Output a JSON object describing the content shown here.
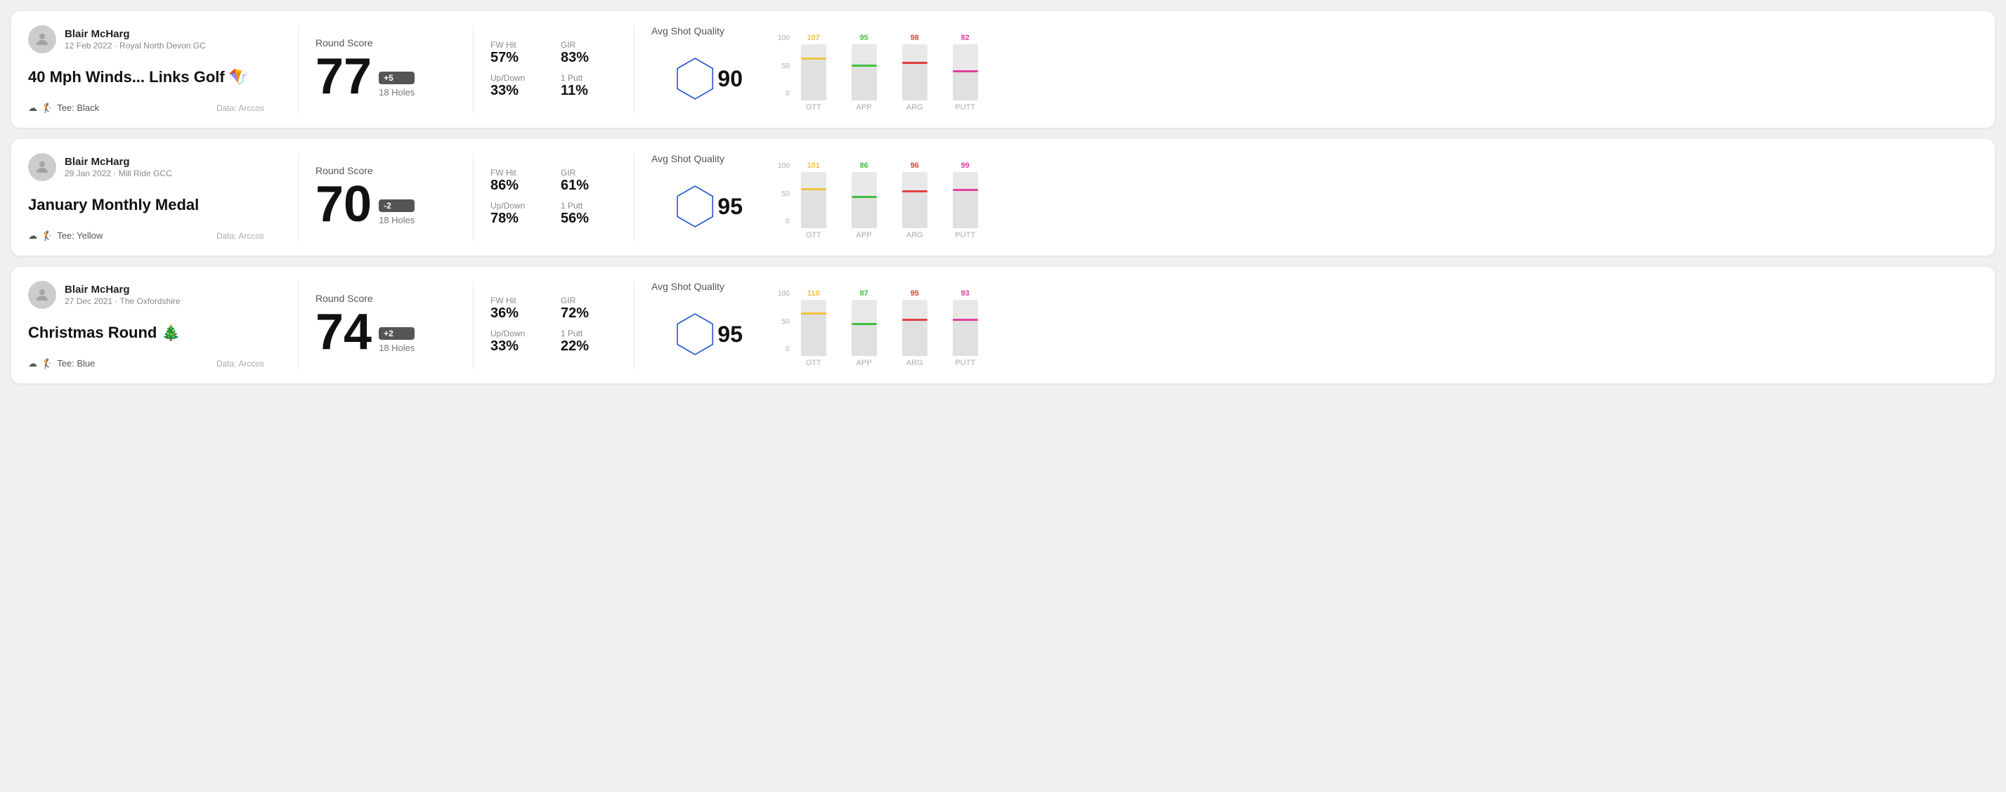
{
  "rounds": [
    {
      "id": "round-1",
      "user": "Blair McHarg",
      "date": "12 Feb 2022 · Royal North Devon GC",
      "title": "40 Mph Winds... Links Golf 🪁",
      "tee": "Black",
      "data_source": "Data: Arccos",
      "round_score_label": "Round Score",
      "score": "77",
      "score_diff": "+5",
      "score_diff_type": "positive",
      "holes": "18 Holes",
      "fw_hit_label": "FW Hit",
      "fw_hit": "57%",
      "gir_label": "GIR",
      "gir": "83%",
      "updown_label": "Up/Down",
      "updown": "33%",
      "putt1_label": "1 Putt",
      "putt1": "11%",
      "quality_label": "Avg Shot Quality",
      "quality_score": "90",
      "chart": {
        "columns": [
          {
            "label": "OTT",
            "value": 107,
            "color": "#f0c040",
            "bar_pct": 72
          },
          {
            "label": "APP",
            "value": 95,
            "color": "#40c040",
            "bar_pct": 60
          },
          {
            "label": "ARG",
            "value": 98,
            "color": "#e04040",
            "bar_pct": 65
          },
          {
            "label": "PUTT",
            "value": 82,
            "color": "#e040a0",
            "bar_pct": 50
          }
        ]
      }
    },
    {
      "id": "round-2",
      "user": "Blair McHarg",
      "date": "29 Jan 2022 · Mill Ride GCC",
      "title": "January Monthly Medal",
      "tee": "Yellow",
      "data_source": "Data: Arccos",
      "round_score_label": "Round Score",
      "score": "70",
      "score_diff": "-2",
      "score_diff_type": "negative",
      "holes": "18 Holes",
      "fw_hit_label": "FW Hit",
      "fw_hit": "86%",
      "gir_label": "GIR",
      "gir": "61%",
      "updown_label": "Up/Down",
      "updown": "78%",
      "putt1_label": "1 Putt",
      "putt1": "56%",
      "quality_label": "Avg Shot Quality",
      "quality_score": "95",
      "chart": {
        "columns": [
          {
            "label": "OTT",
            "value": 101,
            "color": "#f0c040",
            "bar_pct": 68
          },
          {
            "label": "APP",
            "value": 86,
            "color": "#40c040",
            "bar_pct": 54
          },
          {
            "label": "ARG",
            "value": 96,
            "color": "#e04040",
            "bar_pct": 64
          },
          {
            "label": "PUTT",
            "value": 99,
            "color": "#e040a0",
            "bar_pct": 66
          }
        ]
      }
    },
    {
      "id": "round-3",
      "user": "Blair McHarg",
      "date": "27 Dec 2021 · The Oxfordshire",
      "title": "Christmas Round 🎄",
      "tee": "Blue",
      "data_source": "Data: Arccos",
      "round_score_label": "Round Score",
      "score": "74",
      "score_diff": "+2",
      "score_diff_type": "positive",
      "holes": "18 Holes",
      "fw_hit_label": "FW Hit",
      "fw_hit": "36%",
      "gir_label": "GIR",
      "gir": "72%",
      "updown_label": "Up/Down",
      "updown": "33%",
      "putt1_label": "1 Putt",
      "putt1": "22%",
      "quality_label": "Avg Shot Quality",
      "quality_score": "95",
      "chart": {
        "columns": [
          {
            "label": "OTT",
            "value": 110,
            "color": "#f0c040",
            "bar_pct": 74
          },
          {
            "label": "APP",
            "value": 87,
            "color": "#40c040",
            "bar_pct": 55
          },
          {
            "label": "ARG",
            "value": 95,
            "color": "#e04040",
            "bar_pct": 63
          },
          {
            "label": "PUTT",
            "value": 93,
            "color": "#e040a0",
            "bar_pct": 62
          }
        ]
      }
    }
  ]
}
